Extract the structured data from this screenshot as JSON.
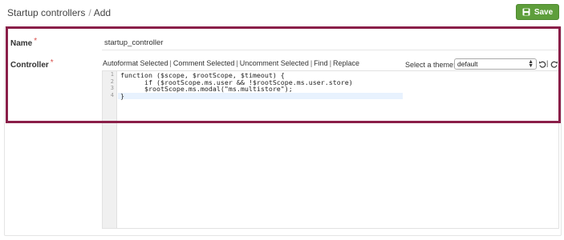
{
  "breadcrumb": {
    "parent": "Startup controllers",
    "separator": "/",
    "current": "Add"
  },
  "toolbar_top": {
    "save_label": "Save",
    "accent": "#5e9e3b"
  },
  "form": {
    "name_label": "Name",
    "required_mark": "*",
    "name_value": "startup_controller",
    "controller_label": "Controller"
  },
  "editor_toolbar": {
    "actions": [
      "Autoformat Selected",
      "Comment Selected",
      "Uncomment Selected",
      "Find",
      "Replace"
    ],
    "theme_label": "Select a theme:",
    "theme_value": "default"
  },
  "code": {
    "line_numbers": [
      "1",
      "2",
      "3",
      "4"
    ],
    "lines": [
      "function ($scope, $rootScope, $timeout) {",
      "      if ($rootScope.ms.user && !$rootScope.ms.user.store)",
      "      $rootScope.ms.modal(\"ms.multistore\");",
      "}"
    ]
  },
  "highlight_color": "#8a1f49"
}
